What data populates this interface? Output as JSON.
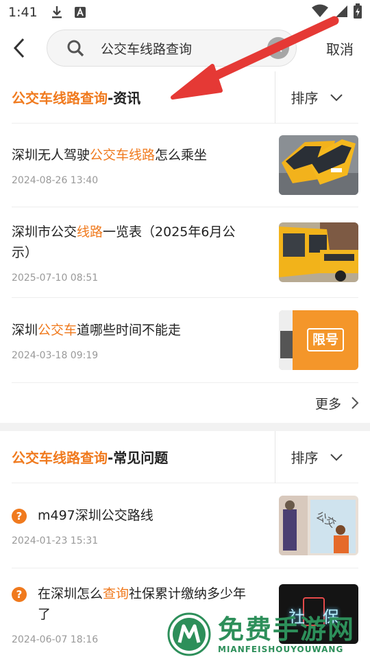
{
  "status": {
    "time": "1:41",
    "icons": [
      "download-icon",
      "text-icon",
      "wifi-icon",
      "signal-icon",
      "battery-icon"
    ]
  },
  "search": {
    "query": "公交车线路查询",
    "cancel_label": "取消"
  },
  "news_section": {
    "title_highlight": "公交车线路查询",
    "title_suffix": "-资讯",
    "sort_label": "排序",
    "items": [
      {
        "pre": "深圳无人驾驶",
        "hl": "公交车线路",
        "post": "怎么乘坐",
        "date": "2024-08-26 13:40"
      },
      {
        "pre": "深圳市公交",
        "hl": "线路",
        "post": "一览表（2025年6月公示）",
        "date": "2025-07-10 08:51"
      },
      {
        "pre": "深圳",
        "hl": "公交车",
        "post": "道哪些时间不能走",
        "date": "2024-03-18 09:19",
        "thumb_text": "限号"
      }
    ],
    "more_label": "更多"
  },
  "faq_section": {
    "title_highlight": "公交车线路查询",
    "title_suffix": "-常见问题",
    "sort_label": "排序",
    "items": [
      {
        "pre": "m497深圳公交路线",
        "hl": "",
        "post": "",
        "date": "2024-01-23 15:31",
        "thumb_text": "公交"
      },
      {
        "pre": "在深圳怎么",
        "hl": "查询",
        "post": "社保累计缴纳多少年了",
        "date": "2024-06-07 18:16",
        "thumb_text": "社保"
      }
    ],
    "badge": "?"
  },
  "watermark": {
    "cn": "免费手游网",
    "en": "MIANFEISHOUYOUWANG"
  },
  "colors": {
    "accent": "#f07a1e",
    "watermark": "#2d8f5a",
    "arrow": "#e53935"
  }
}
